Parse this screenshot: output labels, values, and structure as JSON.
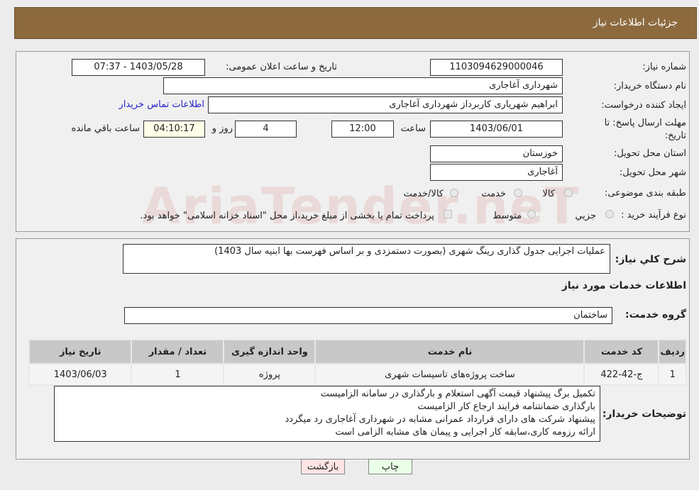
{
  "header": {
    "title": "جزئیات اطلاعات نیاز"
  },
  "watermark": "AriaTender.neT",
  "fields": {
    "need_number_label": "شماره نیاز:",
    "need_number": "1103094629000046",
    "announce_label": "تاریخ و ساعت اعلان عمومی:",
    "announce_value": "1403/05/28 - 07:37",
    "buyer_label": "نام دستگاه خریدار:",
    "buyer": "شهرداری آغاجاری",
    "creator_label": "ایجاد کننده درخواست:",
    "creator": "ابراهیم شهریاری کاربرداز شهرداری آغاجاری",
    "contact_link": "اطلاعات تماس خریدار",
    "deadline_label": "مهلت ارسال پاسخ: تا تاریخ:",
    "deadline_date": "1403/06/01",
    "time_label": "ساعت",
    "deadline_time": "12:00",
    "days": "4",
    "days_label": "روز و",
    "remaining": "04:10:17",
    "remaining_label": "ساعت باقي مانده",
    "province_label": "استان محل تحویل:",
    "province": "خوزستان",
    "city_label": "شهر محل تحویل:",
    "city": "آغاجاری",
    "category_label": "طبقه بندی موضوعی:",
    "category_options": [
      "کالا",
      "خدمت",
      "کالا/خدمت"
    ],
    "process_label": "نوع فرآیند خرید :",
    "process_options": [
      "جزیي",
      "متوسط"
    ],
    "process_note": "پرداخت تمام یا بخشی از مبلغ خرید،از محل \"اسناد خزانه اسلامی\" خواهد بود."
  },
  "need": {
    "desc_label": "شرح كلي نياز:",
    "desc": "عملیات اجرایی جدول گذاری رینگ شهری (بصورت دستمزدی و بر اساس فهرست بها ابنیه سال 1403)",
    "services_title": "اطلاعات خدمات مورد نياز",
    "group_label": "گروه خدمت:",
    "group": "ساختمان",
    "table": {
      "headers": [
        "ردیف",
        "کد خدمت",
        "نام خدمت",
        "واحد اندازه گیری",
        "تعداد / مقدار",
        "تاریخ نیاز"
      ],
      "rows": [
        [
          "1",
          "ج-42-422",
          "ساخت پروژه‌های تاسیسات شهری",
          "پروژه",
          "1",
          "1403/06/03"
        ]
      ]
    },
    "notes_label": "توضیحات خریدار:",
    "notes": [
      "تکمیل برگ پیشنهاد قیمت آگهی استعلام و بارگذاری در سامانه الزامیست",
      "بارگذاری ضمانتنامه فرایند ارجاع کار الزامیست",
      "پیشنهاد شرکت های دارای قرارداد عمرانی مشابه در شهرداری آغاجاری رد میگردد",
      "ارائه رزومه کاری،سابقه کار اجرایی و پیمان های مشابه الزامی است"
    ]
  },
  "buttons": {
    "print": "چاپ",
    "back": "بازگشت"
  }
}
